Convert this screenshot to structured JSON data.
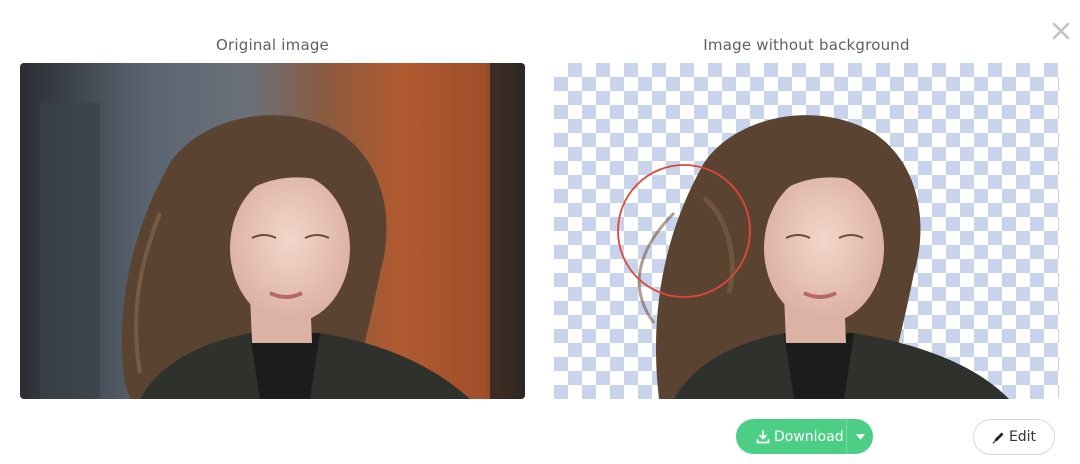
{
  "dialog": {
    "close_icon": "close-icon"
  },
  "original": {
    "title": "Original image"
  },
  "result": {
    "title": "Image without background"
  },
  "actions": {
    "download_label": "Download",
    "download_icon": "download-icon",
    "dropdown_icon": "caret-down-icon",
    "edit_label": "Edit",
    "edit_icon": "pencil-icon"
  },
  "colors": {
    "download_bg": "#4ccf84",
    "checker": "#c7d4ec",
    "magnifier_ring": "#e0463a"
  }
}
